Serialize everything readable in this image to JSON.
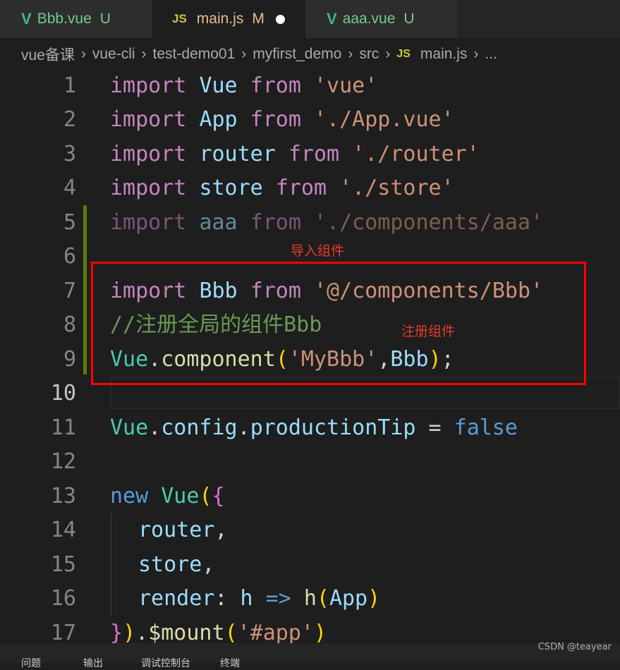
{
  "tabs": [
    {
      "icon": "vue-icon",
      "name": "Bbb.vue",
      "status": "U",
      "active": false
    },
    {
      "icon": "js-icon",
      "glyph": "JS",
      "name": "main.js",
      "status": "M",
      "active": true
    },
    {
      "icon": "vue-icon",
      "name": "aaa.vue",
      "status": "U",
      "active": false
    }
  ],
  "breadcrumb": {
    "items": [
      "vue备课",
      "vue-cli",
      "test-demo01",
      "myfirst_demo",
      "src"
    ],
    "file_icon": "JS",
    "file": "main.js",
    "more": "..."
  },
  "editor": {
    "line_numbers": [
      "1",
      "2",
      "3",
      "4",
      "5",
      "6",
      "7",
      "8",
      "9",
      "10",
      "11",
      "12",
      "13",
      "14",
      "15",
      "16",
      "17"
    ],
    "current_line": "10"
  },
  "code": {
    "l1": {
      "kw": "import",
      "name": "Vue",
      "from": "from",
      "str": "'vue'"
    },
    "l2": {
      "kw": "import",
      "name": "App",
      "from": "from",
      "str": "'./App.vue'"
    },
    "l3": {
      "kw": "import",
      "name": "router",
      "from": "from",
      "str": "'./router'"
    },
    "l4": {
      "kw": "import",
      "name": "store",
      "from": "from",
      "str": "'./store'"
    },
    "l5": {
      "kw": "import",
      "name": "aaa",
      "from": "from",
      "str": "'./components/aaa'"
    },
    "l7": {
      "kw": "import",
      "name": "Bbb",
      "from": "from",
      "str": "'@/components/Bbb'"
    },
    "l8": {
      "comment": "//注册全局的组件Bbb"
    },
    "l9": {
      "obj": "Vue",
      "dot": ".",
      "fn": "component",
      "open": "(",
      "str": "'MyBbb'",
      "comma": ",",
      "arg": "Bbb",
      "close": ")",
      "semi": ";"
    },
    "l11": {
      "obj": "Vue",
      "dot1": ".",
      "prop1": "config",
      "dot2": ".",
      "prop2": "productionTip",
      "eq": " = ",
      "val": "false"
    },
    "l13": {
      "kw": "new",
      "cls": "Vue",
      "open1": "(",
      "open2": "{"
    },
    "l14": {
      "key": "router",
      "comma": ","
    },
    "l15": {
      "key": "store",
      "comma": ","
    },
    "l16": {
      "key": "render",
      "colon": ": ",
      "param": "h",
      "arrow": " => ",
      "fn": "h",
      "open": "(",
      "arg": "App",
      "close": ")"
    },
    "l17": {
      "close2": "}",
      "close1": ")",
      "dot": ".",
      "fn": "$mount",
      "open": "(",
      "str": "'#app'",
      "close": ")"
    }
  },
  "annotations": {
    "import_component": "导入组件",
    "register_component": "注册组件"
  },
  "bottom_panel": [
    "问题",
    "输出",
    "调试控制台",
    "终端"
  ],
  "watermark": "CSDN @teayear",
  "colors": {
    "keyword": "#c586c0",
    "variable": "#9cdcfe",
    "string": "#ce9178",
    "comment": "#6a9955",
    "class": "#4ec9b0",
    "annotation_red": "#ff0000"
  }
}
